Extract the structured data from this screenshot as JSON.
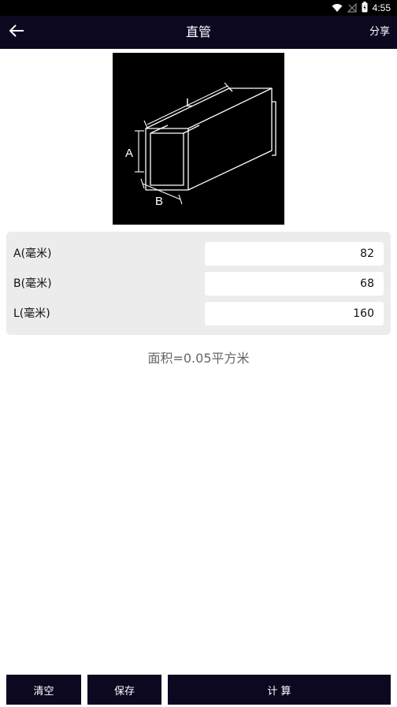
{
  "status_bar": {
    "time": "4:55",
    "icons": [
      "wifi-icon",
      "no-signal-icon",
      "battery-icon"
    ]
  },
  "header": {
    "back_icon": "arrow-left-icon",
    "title": "直管",
    "share_label": "分享"
  },
  "diagram": {
    "label_length": "L",
    "label_height": "A",
    "label_width": "B"
  },
  "form": {
    "rows": [
      {
        "label": "A(毫米)",
        "value": "82"
      },
      {
        "label": "B(毫米)",
        "value": "68"
      },
      {
        "label": "L(毫米)",
        "value": "160"
      }
    ]
  },
  "result": {
    "text": "面积=0.05平方米"
  },
  "buttons": {
    "clear": "清空",
    "save": "保存",
    "calculate": "计 算"
  },
  "colors": {
    "app_bar": "#0c0820",
    "card_bg": "#ececec",
    "result_text": "#666666"
  }
}
